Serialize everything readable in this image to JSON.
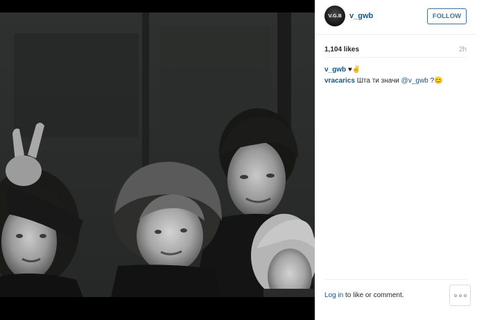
{
  "post": {
    "photo_alt": "",
    "author": {
      "username": "v_gwb",
      "avatar_text": "V.G.B"
    },
    "follow_label": "FOLLOW",
    "likes": "1,104 likes",
    "time": "2h",
    "caption": {
      "user": "v_gwb",
      "text": "♥︎✌️"
    },
    "comments": [
      {
        "user": "vracarics",
        "text": "Шта ти значи ",
        "mention": "@v_gwb",
        "suffix": " ?😊"
      }
    ],
    "footer": {
      "login_link": "Log in",
      "login_rest": " to like or comment."
    },
    "more_icon": "more-dots-icon"
  },
  "colors": {
    "link": "#125688",
    "follow": "#3f729b",
    "muted": "#a5a7aa"
  }
}
